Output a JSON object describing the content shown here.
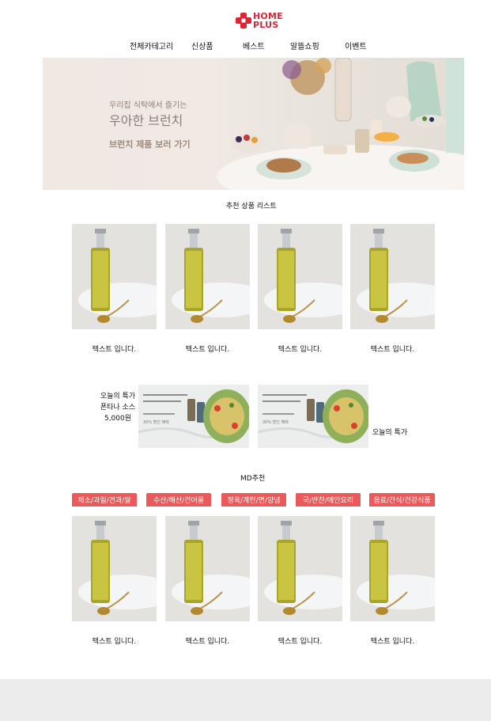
{
  "logo": {
    "line1": "HOME",
    "line2": "PLUS",
    "brand_color": "#e02436"
  },
  "nav": {
    "items": [
      {
        "label": "전체카테고리"
      },
      {
        "label": "신상품"
      },
      {
        "label": "베스트"
      },
      {
        "label": "알뜰쇼핑"
      },
      {
        "label": "이벤트"
      }
    ]
  },
  "hero": {
    "subtitle": "우리집 식탁에서 즐기는",
    "title": "우아한 브런치",
    "link": "브런치 제품 보러 가기",
    "text_color": "#8e7f77"
  },
  "recommend": {
    "title": "추천 상품 리스트",
    "products": [
      {
        "caption": "텍스트 입니다."
      },
      {
        "caption": "텍스트 입니다."
      },
      {
        "caption": "텍스트 입니다."
      },
      {
        "caption": "텍스트 입니다."
      }
    ]
  },
  "deal": {
    "left_text": "오늘의 특가 폰타나 소스 5,000원",
    "right_text": "오늘의 특가",
    "banner_caption": "30% 할인 혜택"
  },
  "md": {
    "title": "MD추천",
    "accent": "#ea5a5a",
    "categories": [
      {
        "label": "채소/과일/견과/쌀"
      },
      {
        "label": "수산/해산/건어물"
      },
      {
        "label": "정육/계란/면/양념"
      },
      {
        "label": "국/반찬/메인요리"
      },
      {
        "label": "음료/간식/건강식품"
      }
    ],
    "products": [
      {
        "caption": "텍스트 입니다."
      },
      {
        "caption": "텍스트 입니다."
      },
      {
        "caption": "텍스트 입니다."
      },
      {
        "caption": "텍스트 입니다."
      }
    ]
  },
  "icons": [
    "homeplus-logo-icon",
    "olive-oil-bottle-image",
    "pasta-banner-image"
  ]
}
